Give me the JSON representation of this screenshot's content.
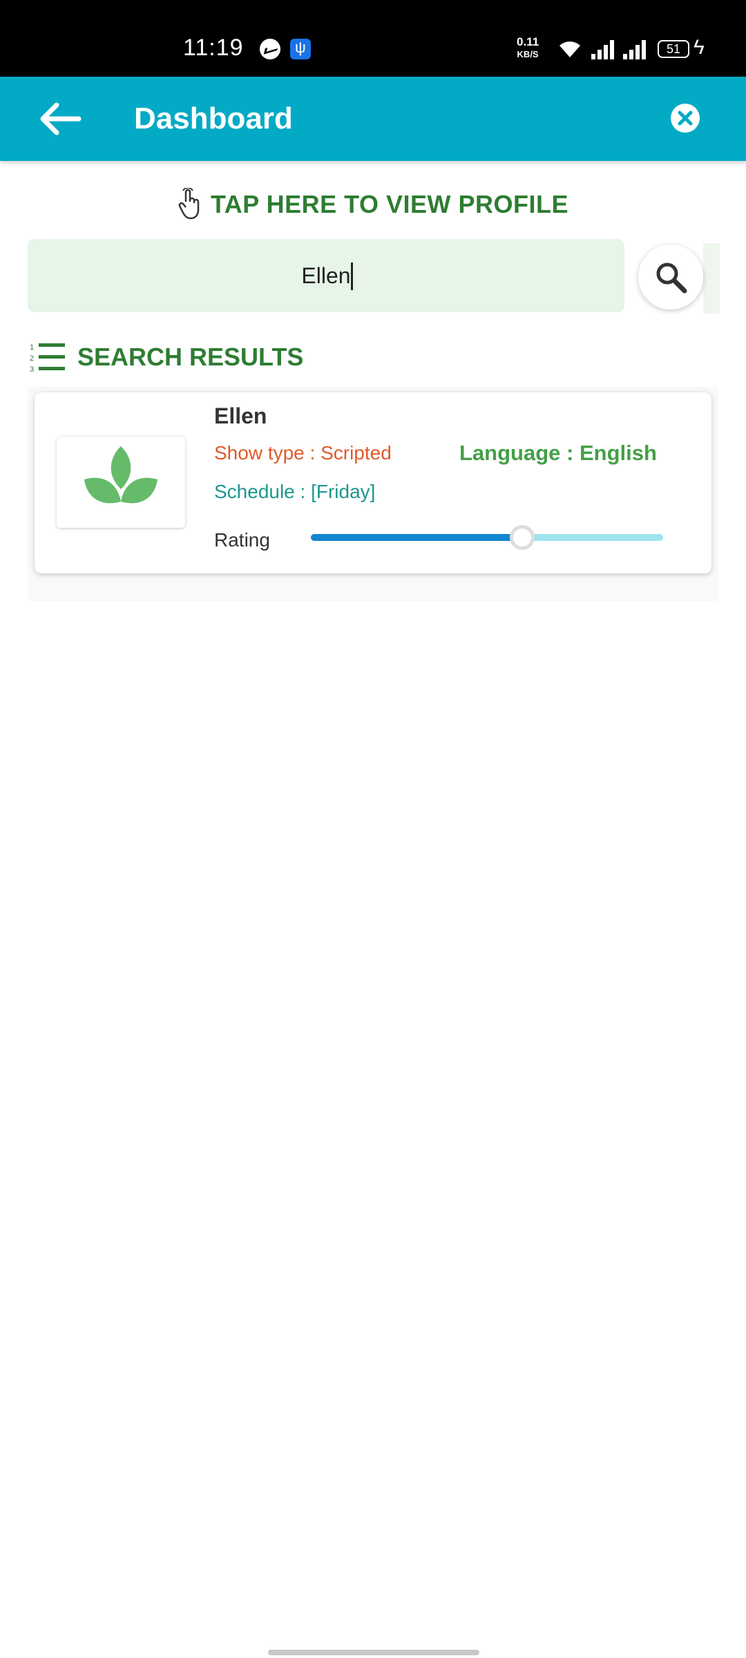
{
  "status_bar": {
    "time": "11:19",
    "net_speed_value": "0.11",
    "net_speed_unit": "KB/S",
    "battery_level": "51",
    "icons": [
      "messenger-icon",
      "usb-icon",
      "wifi-icon",
      "signal-icon",
      "signal-icon",
      "battery-icon",
      "charging-icon"
    ]
  },
  "app_bar": {
    "title": "Dashboard",
    "back_icon": "arrow-left-icon",
    "close_icon": "close-circle-icon",
    "color": "#02aac5"
  },
  "profile_prompt": {
    "label": "TAP HERE TO VIEW PROFILE",
    "icon": "hand-pointer-icon",
    "color": "#2e7d32"
  },
  "search": {
    "value": "Ellen",
    "placeholder": "",
    "button_icon": "search-icon"
  },
  "results": {
    "title": "SEARCH RESULTS",
    "icon": "numbered-list-icon",
    "items": [
      {
        "name": "Ellen",
        "thumbnail_icon": "leaf-logo-icon",
        "show_type_label": "Show type : Scripted",
        "language_label": "Language : English",
        "schedule_label": "Schedule : [Friday]",
        "rating_label": "Rating",
        "rating_fraction": 0.6
      }
    ]
  }
}
